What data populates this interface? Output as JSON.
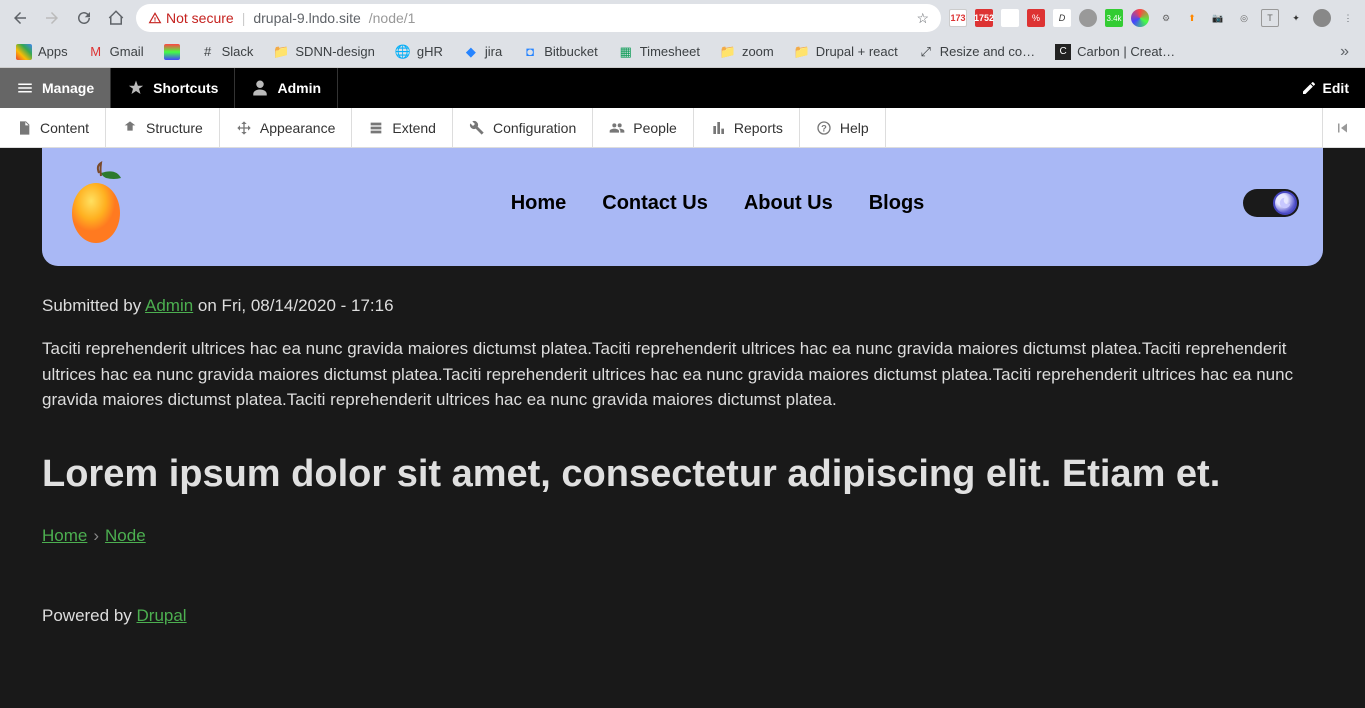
{
  "browser": {
    "not_secure": "Not secure",
    "url_host": "drupal-9.lndo.site",
    "url_path": "/node/1",
    "bookmarks": [
      "Apps",
      "Gmail",
      "",
      "Slack",
      "SDNN-design",
      "gHR",
      "jira",
      "Bitbucket",
      "Timesheet",
      "zoom",
      "Drupal + react",
      "Resize and co…",
      "Carbon | Creat…"
    ]
  },
  "drupal_toolbar": {
    "manage": "Manage",
    "shortcuts": "Shortcuts",
    "admin": "Admin",
    "edit": "Edit"
  },
  "drupal_menu": {
    "content": "Content",
    "structure": "Structure",
    "appearance": "Appearance",
    "extend": "Extend",
    "configuration": "Configuration",
    "people": "People",
    "reports": "Reports",
    "help": "Help"
  },
  "nav": {
    "home": "Home",
    "contact": "Contact Us",
    "about": "About Us",
    "blogs": "Blogs"
  },
  "article": {
    "submitted_prefix": "Submitted by ",
    "submitted_author": "Admin",
    "submitted_date": " on Fri, 08/14/2020 - 17:16",
    "body": "Taciti reprehenderit ultrices hac ea nunc gravida maiores dictumst platea.Taciti reprehenderit ultrices hac ea nunc gravida maiores dictumst platea.Taciti reprehenderit ultrices hac ea nunc gravida maiores dictumst platea.Taciti reprehenderit ultrices hac ea nunc gravida maiores dictumst platea.Taciti reprehenderit ultrices hac ea nunc gravida maiores dictumst platea.Taciti reprehenderit ultrices hac ea nunc gravida maiores dictumst platea.",
    "title": "Lorem ipsum dolor sit amet, consectetur adipiscing elit. Etiam et."
  },
  "breadcrumbs": {
    "home": "Home",
    "node": "Node"
  },
  "footer": {
    "powered_prefix": "Powered by ",
    "powered_link": "Drupal"
  }
}
